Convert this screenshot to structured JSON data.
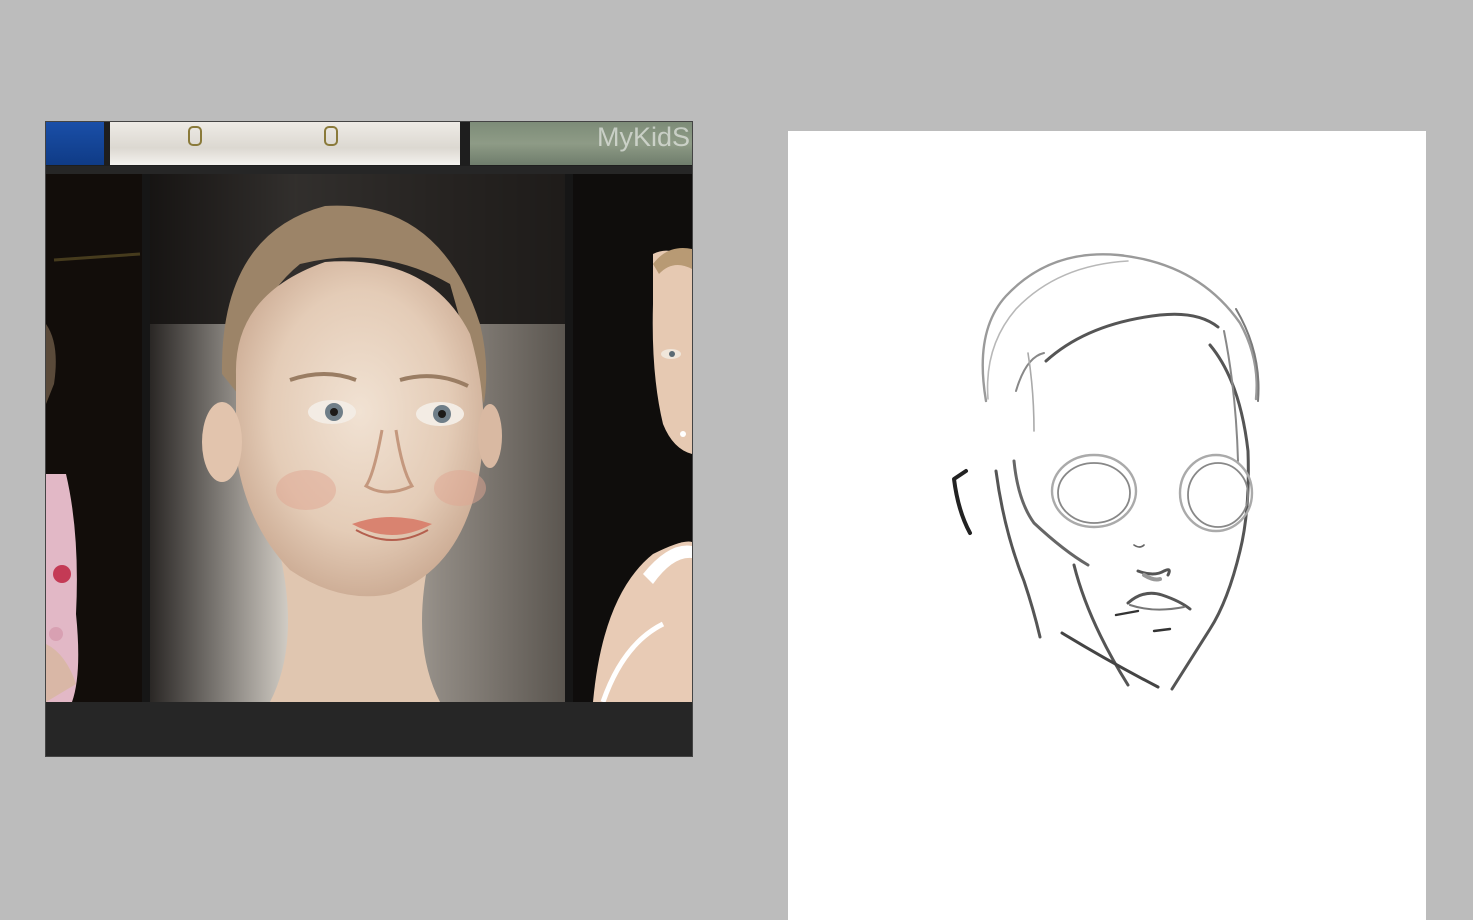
{
  "reference_panel": {
    "thumbnails": [
      {
        "name": "thumb-blue"
      },
      {
        "name": "thumb-white"
      },
      {
        "name": "thumb-green",
        "watermark": "MyKidS"
      }
    ],
    "photos": [
      {
        "name": "photo-left"
      },
      {
        "name": "photo-center",
        "subject": "portrait"
      },
      {
        "name": "photo-right"
      }
    ]
  },
  "colors": {
    "workspace_bg": "#bcbcbc",
    "panel_bg": "#262626",
    "canvas_bg": "#ffffff",
    "stroke": "#333333"
  }
}
